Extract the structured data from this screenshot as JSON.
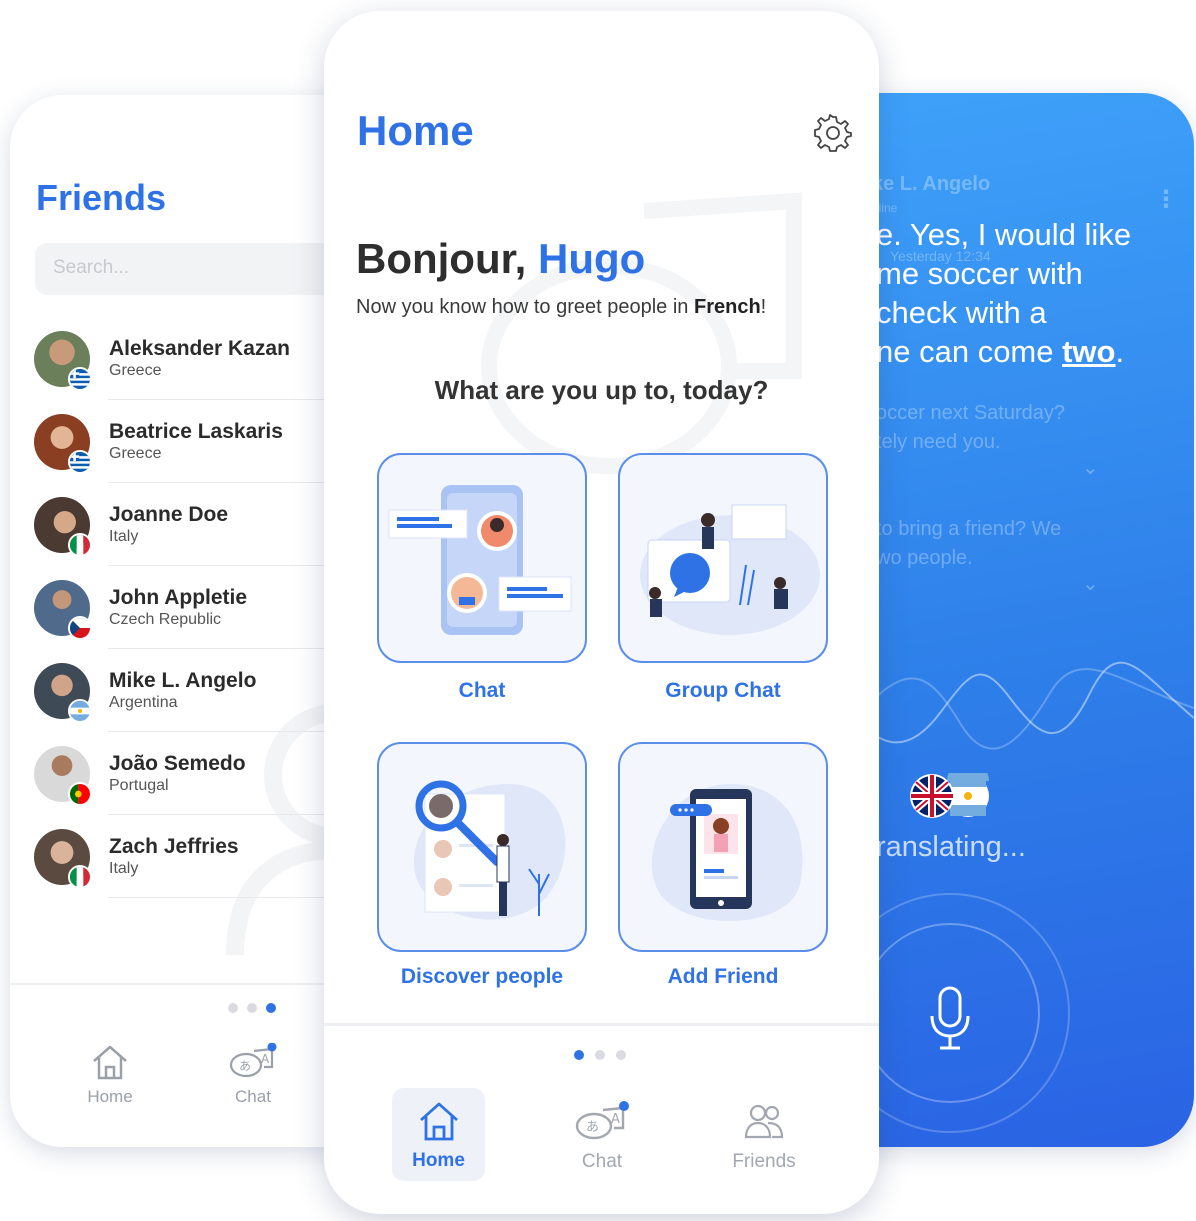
{
  "colors": {
    "accent": "#2f72e6",
    "gradient_top": "#3fa2fa",
    "gradient_bottom": "#2a63e4"
  },
  "friends_screen": {
    "title": "Friends",
    "search_placeholder": "Search...",
    "friends": [
      {
        "name": "Aleksander Kazan",
        "country": "Greece"
      },
      {
        "name": "Beatrice Laskaris",
        "country": "Greece"
      },
      {
        "name": "Joanne Doe",
        "country": "Italy"
      },
      {
        "name": "John Appletie",
        "country": "Czech Republic"
      },
      {
        "name": "Mike L. Angelo",
        "country": "Argentina"
      },
      {
        "name": "João Semedo",
        "country": "Portugal"
      },
      {
        "name": "Zach Jeffries",
        "country": "Italy"
      }
    ],
    "nav": {
      "home": "Home",
      "chat": "Chat"
    }
  },
  "home_screen": {
    "title": "Home",
    "greeting": "Bonjour, ",
    "user_name": "Hugo",
    "subtitle_prefix": "Now you know how to greet people in ",
    "subtitle_language": "French",
    "subtitle_suffix": "!",
    "question": "What are you up to, today?",
    "cards": [
      {
        "label": "Chat",
        "icon": "chat-illustration"
      },
      {
        "label": "Group Chat",
        "icon": "group-chat-illustration"
      },
      {
        "label": "Discover people",
        "icon": "discover-illustration"
      },
      {
        "label": "Add Friend",
        "icon": "add-friend-illustration"
      }
    ],
    "nav": {
      "home": "Home",
      "chat": "Chat",
      "friends": "Friends"
    }
  },
  "translate_screen": {
    "contact_name": "ke L. Angelo",
    "contact_status": "nline",
    "timestamp": "Yesterday 12:34",
    "translated_lines": [
      "e. Yes, I would like",
      "me soccer with",
      "check with a"
    ],
    "last_line_prefix": "ne can come ",
    "last_line_emphasis": "two",
    "last_line_suffix": ".",
    "faded_message_1": [
      "occer next Saturday?",
      "tely need you."
    ],
    "faded_message_2": [
      "to bring a friend? We",
      "wo people."
    ],
    "status": "ranslating..."
  }
}
